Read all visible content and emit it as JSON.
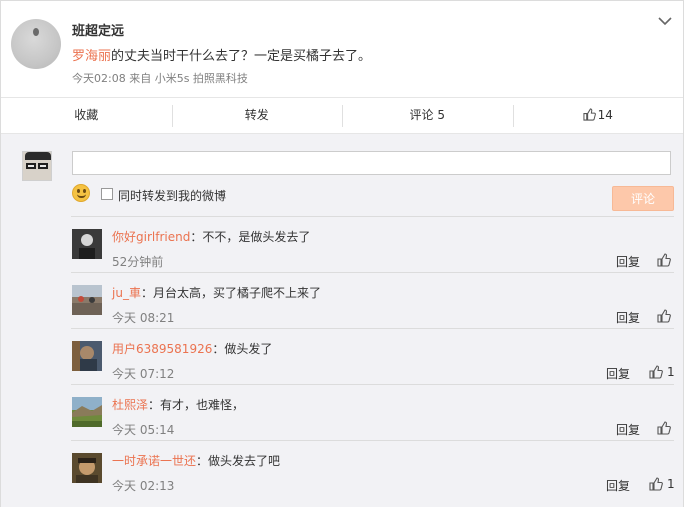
{
  "post": {
    "author": "班超定远",
    "mention": "罗海丽",
    "text": "的丈夫当时干什么去了？一定是买橘子去了。",
    "meta": "今天02:08 来自 小米5s 拍照黑科技"
  },
  "actions": {
    "favorite": "收藏",
    "repost": "转发",
    "comment": "评论 5",
    "like_count": "14"
  },
  "composer": {
    "input_value": "",
    "repost_label": "同时转发到我的微博",
    "submit_label": "评论"
  },
  "comments": [
    {
      "name": "你好girlfriend",
      "text": "：不不，是做头发去了",
      "time": "52分钟前",
      "reply": "回复",
      "likes": ""
    },
    {
      "name": "ju_車",
      "text": "：月台太高，买了橘子爬不上来了",
      "time": "今天 08:21",
      "reply": "回复",
      "likes": ""
    },
    {
      "name": "用户6389581926",
      "text": "：做头发了",
      "time": "今天 07:12",
      "reply": "回复",
      "likes": "1"
    },
    {
      "name": "杜熙泽",
      "text": "：有才，也难怪，",
      "time": "今天 05:14",
      "reply": "回复",
      "likes": ""
    },
    {
      "name": "一时承诺一世还",
      "text": "：做头发去了吧",
      "time": "今天 02:13",
      "reply": "回复",
      "likes": "1"
    }
  ],
  "colors": {
    "accent_orange": "#eb7350",
    "submit_disabled": "#fdc8aa",
    "comment_bg": "#f2f2f5"
  }
}
